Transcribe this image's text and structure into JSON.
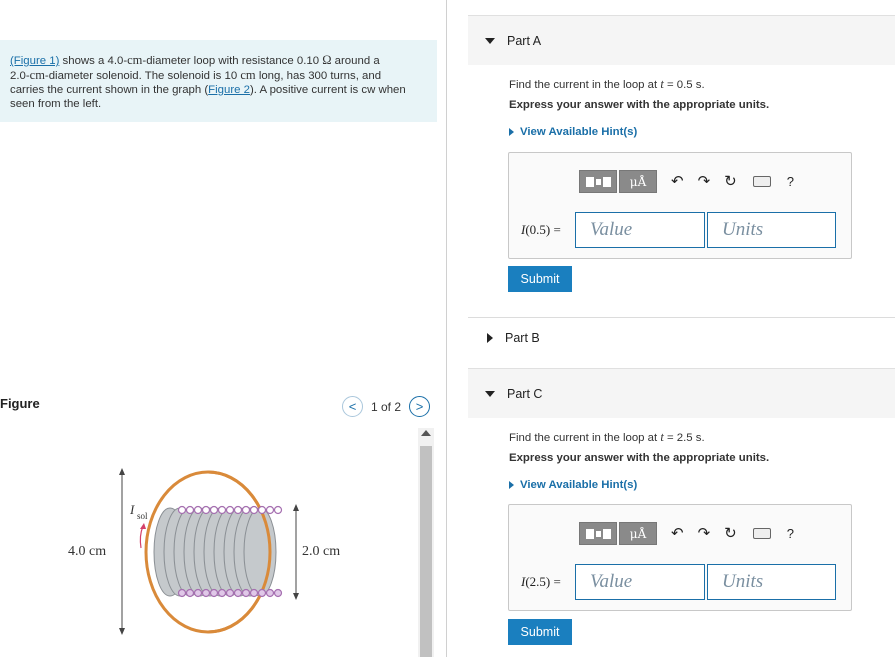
{
  "problem": {
    "figure1_link": "(Figure 1)",
    "text_a": " shows a 4.0-",
    "cm1": "cm",
    "text_b": "-diameter loop with resistance 0.10 ",
    "ohm": "Ω",
    "text_c": " around a",
    "text_d": "2.0-",
    "cm2": "cm",
    "text_e": "-diameter solenoid.  The solenoid is 10 ",
    "cm3": "cm",
    "text_f": " long, has 300 turns, and",
    "text_g": "carries the current shown in the graph (",
    "figure2_link": "Figure 2",
    "text_h": "). A positive current is cw when",
    "text_i": "seen from the left."
  },
  "figure": {
    "label": "Figure",
    "pager_count": "1 of 2",
    "prev_glyph": "<",
    "next_glyph": ">",
    "dim_left": "4.0 cm",
    "dim_right": "2.0 cm",
    "isol_main": "I",
    "isol_sub": "sol"
  },
  "parts": [
    {
      "title": "Part A",
      "expanded": true,
      "prompt_pre": "Find the current in the loop at ",
      "prompt_var": "t",
      "prompt_post": " = 0.5 s.",
      "instruction": "Express your answer with the appropriate units.",
      "hint_label": "View Available Hint(s)",
      "eq_var": "I",
      "eq_arg": "(0.5) =",
      "value_placeholder": "Value",
      "units_placeholder": "Units",
      "submit_label": "Submit"
    },
    {
      "title": "Part B",
      "expanded": false
    },
    {
      "title": "Part C",
      "expanded": true,
      "prompt_pre": "Find the current in the loop at ",
      "prompt_var": "t",
      "prompt_post": " = 2.5 s.",
      "instruction": "Express your answer with the appropriate units.",
      "hint_label": "View Available Hint(s)",
      "eq_var": "I",
      "eq_arg": "(2.5) =",
      "value_placeholder": "Value",
      "units_placeholder": "Units",
      "submit_label": "Submit"
    }
  ],
  "toolbar": {
    "units_button": "μÅ",
    "help_glyph": "?",
    "icons": [
      "templates-icon",
      "units-icon",
      "undo-icon",
      "redo-icon",
      "reset-icon",
      "keyboard-icon",
      "help-icon"
    ]
  }
}
